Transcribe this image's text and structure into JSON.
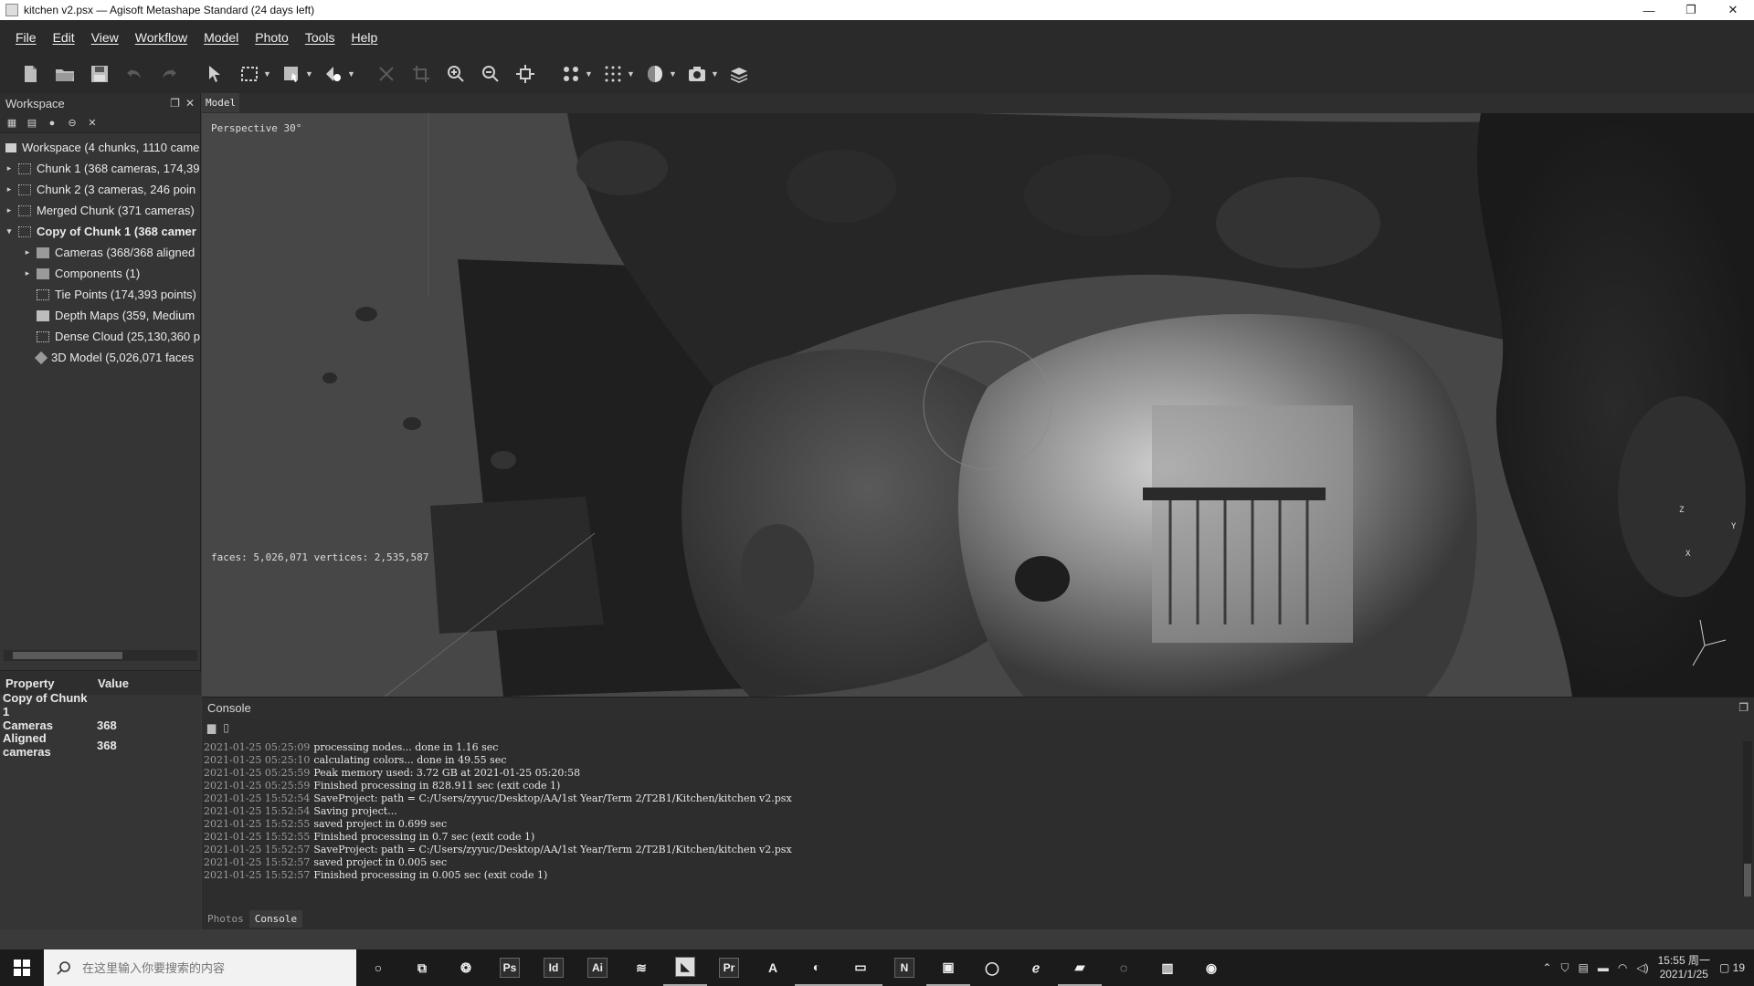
{
  "window": {
    "title": "kitchen v2.psx — Agisoft Metashape Standard (24 days left)",
    "minimize": "—",
    "maximize": "❐",
    "close": "✕"
  },
  "menu": [
    "File",
    "Edit",
    "View",
    "Workflow",
    "Model",
    "Photo",
    "Tools",
    "Help"
  ],
  "workspace": {
    "title": "Workspace",
    "tree": [
      {
        "label": "Workspace (4 chunks, 1110 came",
        "level": 0,
        "arrow": "",
        "bold": false
      },
      {
        "label": "Chunk 1 (368 cameras, 174,39",
        "level": 1,
        "arrow": "▸",
        "bold": false
      },
      {
        "label": "Chunk 2 (3 cameras, 246 poin",
        "level": 1,
        "arrow": "▸",
        "bold": false
      },
      {
        "label": "Merged Chunk (371 cameras)",
        "level": 1,
        "arrow": "▸",
        "bold": false
      },
      {
        "label": "Copy of Chunk 1 (368 camer",
        "level": 1,
        "arrow": "▾",
        "bold": true
      },
      {
        "label": "Cameras (368/368 aligned",
        "level": 2,
        "arrow": "▸",
        "bold": false
      },
      {
        "label": "Components (1)",
        "level": 2,
        "arrow": "▸",
        "bold": false
      },
      {
        "label": "Tie Points (174,393 points)",
        "level": 2,
        "arrow": "",
        "bold": false
      },
      {
        "label": "Depth Maps (359, Medium",
        "level": 2,
        "arrow": "",
        "bold": false
      },
      {
        "label": "Dense Cloud (25,130,360 p",
        "level": 2,
        "arrow": "",
        "bold": false
      },
      {
        "label": "3D Model (5,026,071 faces",
        "level": 2,
        "arrow": "",
        "bold": false
      }
    ]
  },
  "properties": {
    "col_property": "Property",
    "col_value": "Value",
    "rows": [
      {
        "key": "Copy of Chunk 1",
        "value": ""
      },
      {
        "key": "Cameras",
        "value": "368"
      },
      {
        "key": "Aligned cameras",
        "value": "368"
      }
    ]
  },
  "viewport": {
    "tab": "Model",
    "projection": "Perspective 30°",
    "stats": "faces: 5,026,071 vertices: 2,535,587",
    "axis_z": "Z",
    "axis_y": "Y",
    "axis_x": "X"
  },
  "console": {
    "title": "Console",
    "lines": [
      {
        "ts": "2021-01-25 05:25:09",
        "msg": "processing nodes...  done in 1.16 sec"
      },
      {
        "ts": "2021-01-25 05:25:10",
        "msg": "calculating colors...  done in 49.55 sec"
      },
      {
        "ts": "2021-01-25 05:25:59",
        "msg": "Peak memory used: 3.72 GB at 2021-01-25 05:20:58"
      },
      {
        "ts": "2021-01-25 05:25:59",
        "msg": "Finished processing in 828.911 sec (exit code 1)"
      },
      {
        "ts": "2021-01-25 15:52:54",
        "msg": "SaveProject: path = C:/Users/zyyuc/Desktop/AA/1st Year/Term 2/T2B1/Kitchen/kitchen v2.psx"
      },
      {
        "ts": "2021-01-25 15:52:54",
        "msg": "Saving project..."
      },
      {
        "ts": "2021-01-25 15:52:55",
        "msg": "saved project in 0.699 sec"
      },
      {
        "ts": "2021-01-25 15:52:55",
        "msg": "Finished processing in 0.7 sec (exit code 1)"
      },
      {
        "ts": "2021-01-25 15:52:57",
        "msg": "SaveProject: path = C:/Users/zyyuc/Desktop/AA/1st Year/Term 2/T2B1/Kitchen/kitchen v2.psx"
      },
      {
        "ts": "2021-01-25 15:52:57",
        "msg": "saved project in 0.005 sec"
      },
      {
        "ts": "2021-01-25 15:52:57",
        "msg": "Finished processing in 0.005 sec (exit code 1)"
      }
    ],
    "tabs": [
      "Photos",
      "Console"
    ]
  },
  "taskbar": {
    "search_placeholder": "在这里输入你要搜索的内容",
    "apps": [
      "Ps",
      "Id",
      "Ai",
      "Pr",
      "A",
      "N"
    ],
    "time": "15:55 周一",
    "date": "2021/1/25",
    "notifications": "19"
  }
}
